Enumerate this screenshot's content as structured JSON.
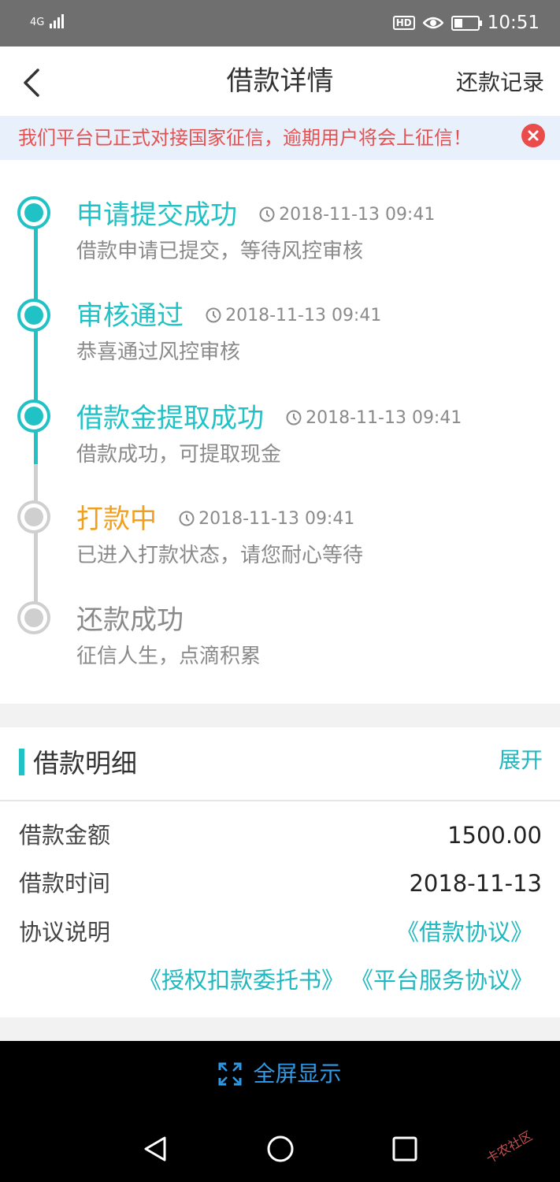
{
  "status_bar": {
    "network": "4G",
    "time": "10:51",
    "hd_badge": "HD",
    "battery_level": 0.35
  },
  "nav": {
    "title": "借款详情",
    "right_link": "还款记录",
    "back_icon": "chevron-left-icon"
  },
  "notice": {
    "text": "我们平台已正式对接国家征信，逾期用户将会上征信！",
    "close_icon": "close-circle-icon"
  },
  "colors": {
    "accent": "#20c2c6",
    "pending": "#f0a020",
    "inactive": "#cfcfcf",
    "notice_text": "#e85050",
    "link": "#20b8bf"
  },
  "timeline": [
    {
      "title": "申请提交成功",
      "time": "2018-11-13 09:41",
      "desc": "借款申请已提交，等待风控审核",
      "state": "done"
    },
    {
      "title": "审核通过",
      "time": "2018-11-13 09:41",
      "desc": "恭喜通过风控审核",
      "state": "done"
    },
    {
      "title": "借款金提取成功",
      "time": "2018-11-13 09:41",
      "desc": "借款成功，可提取现金",
      "state": "done"
    },
    {
      "title": "打款中",
      "time": "2018-11-13 09:41",
      "desc": "已进入打款状态，请您耐心等待",
      "state": "current"
    },
    {
      "title": "还款成功",
      "time": "",
      "desc": "征信人生，点滴积累",
      "state": "todo"
    }
  ],
  "detail": {
    "title": "借款明细",
    "expand": "展开",
    "rows": [
      {
        "label": "借款金额",
        "value": "1500.00"
      },
      {
        "label": "借款时间",
        "value": "2018-11-13"
      }
    ],
    "agreement_label": "协议说明",
    "agreements": [
      "《借款协议》",
      "《授权扣款委托书》",
      "《平台服务协议》"
    ]
  },
  "fullscreen": {
    "label": "全屏显示",
    "icon": "expand-icon"
  },
  "watermark": "卡农社区"
}
